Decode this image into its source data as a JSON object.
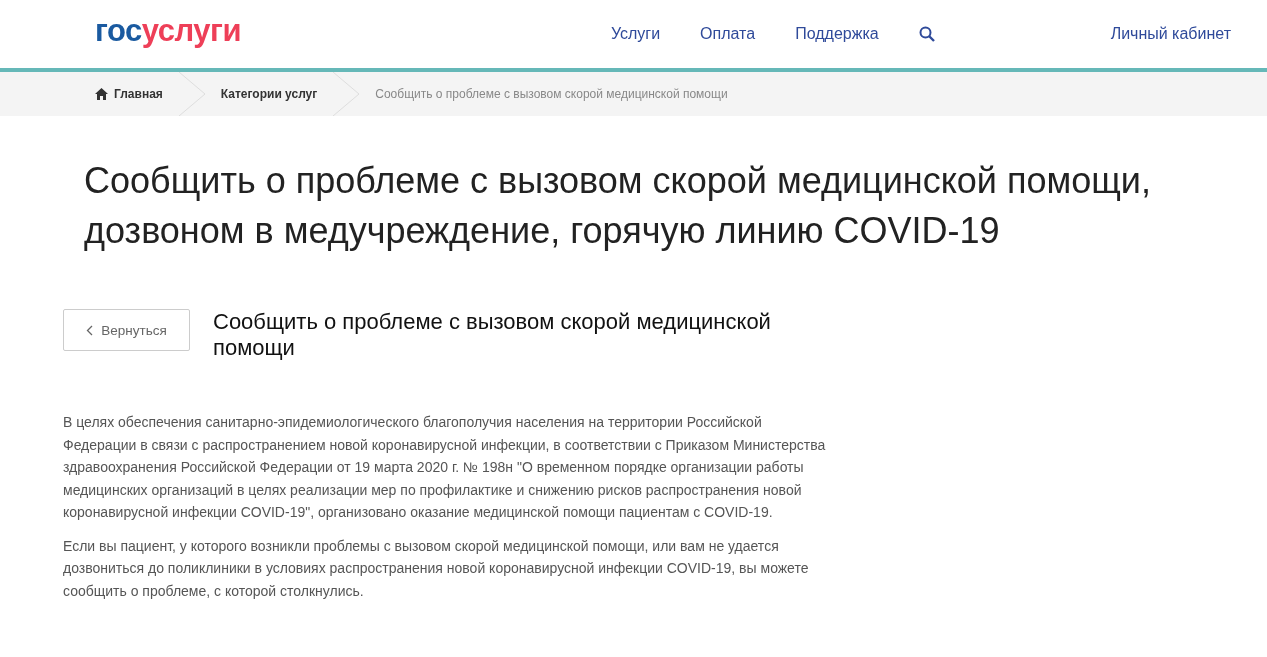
{
  "header": {
    "logo": {
      "part_1": "гос",
      "part_2": "услуги"
    },
    "nav": [
      "Услуги",
      "Оплата",
      "Поддержка"
    ],
    "account_link": "Личный кабинет"
  },
  "breadcrumbs": [
    {
      "label": "Главная",
      "kind": "home"
    },
    {
      "label": "Категории услуг",
      "kind": "link"
    },
    {
      "label": "Сообщить о проблеме с вызовом скорой медицинской помощи",
      "kind": "current"
    }
  ],
  "title": "Сообщить о проблеме с вызовом скорой медицинской помощи, дозвоном в медучреждение, горячую линию COVID-19",
  "back_button": "Вернуться",
  "subtitle": "Сообщить о проблеме с вызовом скорой медицинской помощи",
  "paragraphs": [
    "В целях обеспечения санитарно-эпидемиологического благополучия населения на территории Российской Федерации в связи с распространением новой коронавирусной инфекции, в соответствии с Приказом Министерства здравоохранения Российской Федерации от 19 марта 2020 г. № 198н \"О временном порядке организации работы медицинских организаций в целях реализации мер по профилактике и снижению рисков распространения новой коронавирусной инфекции COVID-19\", организовано оказание медицинской помощи пациентам с COVID-19.",
    "Если вы пациент, у которого возникли проблемы с вызовом скорой медицинской помощи, или вам не удается дозвониться до поликлиники в условиях распространения новой коронавирусной инфекции COVID-19, вы можете сообщить о проблеме, с которой столкнулись."
  ]
}
